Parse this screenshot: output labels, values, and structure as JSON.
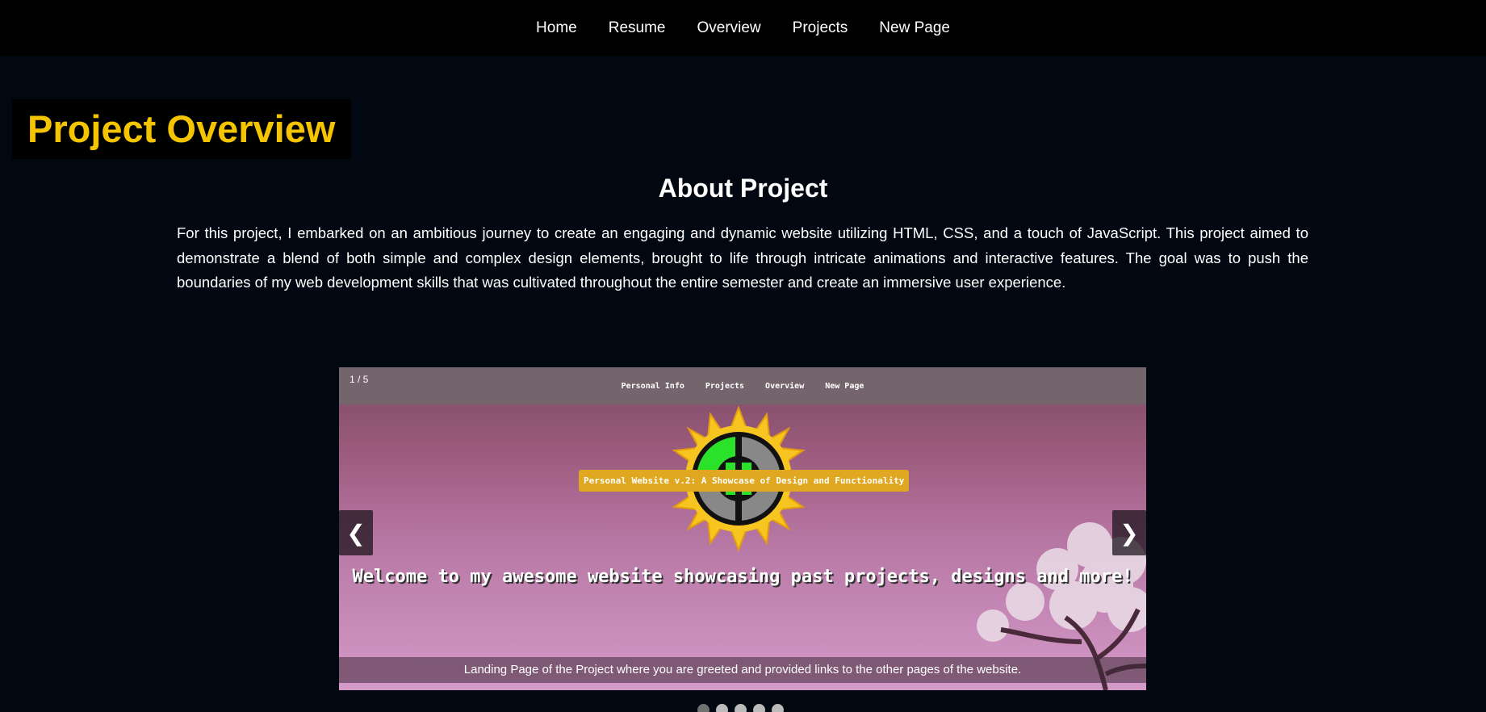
{
  "nav": {
    "items": [
      "Home",
      "Resume",
      "Overview",
      "Projects",
      "New Page"
    ]
  },
  "page": {
    "title": "Project Overview",
    "about_heading": "About Project",
    "about_text": "For this project, I embarked on an ambitious journey to create an engaging and dynamic website utilizing HTML, CSS, and a touch of JavaScript. This project aimed to demonstrate a blend of both simple and complex design elements, brought to life through intricate animations and interactive features. The goal was to push the boundaries of my web development skills that was cultivated throughout the entire semester and create an immersive user experience."
  },
  "slideshow": {
    "counter": "1 / 5",
    "slide_nav": [
      "Personal Info",
      "Projects",
      "Overview",
      "New Page"
    ],
    "slide_tag": "Personal Website v.2: A Showcase of Design and Functionality",
    "slide_welcome": "Welcome to my awesome website showcasing past projects, designs and more!",
    "caption": "Landing Page of the Project where you are greeted and provided links to the other pages of the website.",
    "prev_label": "❮",
    "next_label": "❯",
    "dot_count": 5,
    "active_dot": 1
  },
  "colors": {
    "title_accent": "#f5c400",
    "background": "#010812",
    "nav_bg": "#010101"
  }
}
